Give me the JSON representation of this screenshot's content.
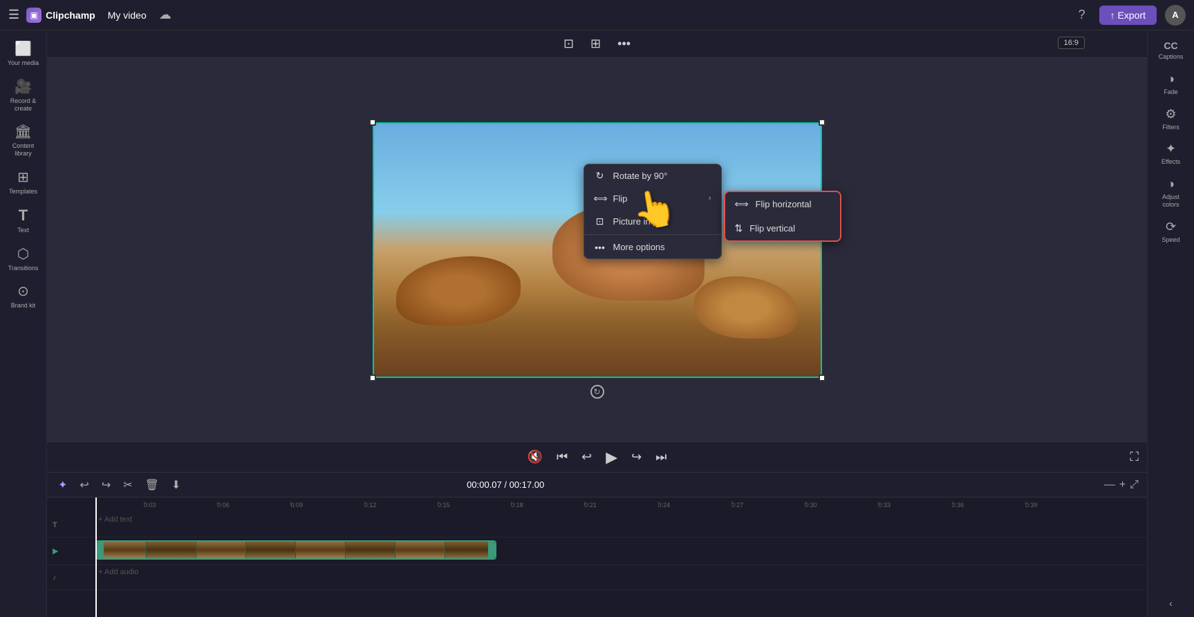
{
  "app": {
    "title": "Clipchamp",
    "video_title": "My video"
  },
  "topbar": {
    "hamburger": "☰",
    "logo_icon": "▣",
    "export_label": "↑ Export",
    "avatar_label": "A",
    "help_icon": "?",
    "cloud_icon": "☁"
  },
  "left_sidebar": {
    "items": [
      {
        "id": "your-media",
        "icon": "⬜",
        "label": "Your media"
      },
      {
        "id": "record-create",
        "icon": "🎥",
        "label": "Record &\ncreate"
      },
      {
        "id": "content-library",
        "icon": "🏛",
        "label": "Content\nlibrary"
      },
      {
        "id": "templates",
        "icon": "⊞",
        "label": "Templates"
      },
      {
        "id": "text",
        "icon": "T",
        "label": "Text"
      },
      {
        "id": "transitions",
        "icon": "⬡",
        "label": "Transitions"
      },
      {
        "id": "brand-kit",
        "icon": "⊙",
        "label": "Brand kit"
      }
    ]
  },
  "right_sidebar": {
    "items": [
      {
        "id": "captions",
        "icon": "CC",
        "label": "Captions"
      },
      {
        "id": "fade",
        "icon": "◑",
        "label": "Fade"
      },
      {
        "id": "filters",
        "icon": "⚙",
        "label": "Filters"
      },
      {
        "id": "effects",
        "icon": "✦",
        "label": "Effects"
      },
      {
        "id": "adjust-colors",
        "icon": "◑",
        "label": "Adjust\ncolors"
      },
      {
        "id": "speed",
        "icon": "⟳",
        "label": "Speed"
      }
    ]
  },
  "video_toolbar": {
    "crop_icon": "⊡",
    "layout_icon": "⊞",
    "more_icon": "•••"
  },
  "context_menu": {
    "items": [
      {
        "id": "rotate",
        "icon": "↻",
        "label": "Rotate by 90°",
        "has_arrow": false
      },
      {
        "id": "flip",
        "icon": "⟺",
        "label": "Flip",
        "has_arrow": true
      },
      {
        "id": "pip",
        "icon": "⊡",
        "label": "Picture in p...",
        "has_arrow": false
      },
      {
        "id": "more",
        "icon": "•••",
        "label": "More options",
        "has_arrow": false
      }
    ]
  },
  "sub_menu": {
    "title": "Flip submenu",
    "items": [
      {
        "id": "flip-h",
        "icon": "⟺",
        "label": "Flip horizontal"
      },
      {
        "id": "flip-v",
        "icon": "⇅",
        "label": "Flip vertical"
      }
    ]
  },
  "aspect_ratio": "16:9",
  "playback": {
    "current_time": "00:00.07",
    "total_time": "00:17.00",
    "time_display": "00:00.07 / 00:17.00"
  },
  "timeline": {
    "toolbar_icons": [
      "✦",
      "↩",
      "↪",
      "✂",
      "🗑",
      "⬇"
    ],
    "zoom_in": "+",
    "zoom_out": "-",
    "expand": "⤢",
    "ruler_marks": [
      "0:03",
      "0:06",
      "0:09",
      "0:12",
      "0:15",
      "0:18",
      "0:21",
      "0:24",
      "0:27",
      "0:30",
      "0:33",
      "0:36",
      "0:39"
    ],
    "text_track_label": "T",
    "text_add_hint": "+ Add text",
    "audio_track_label": "♪",
    "audio_add_hint": "+ Add audio"
  }
}
